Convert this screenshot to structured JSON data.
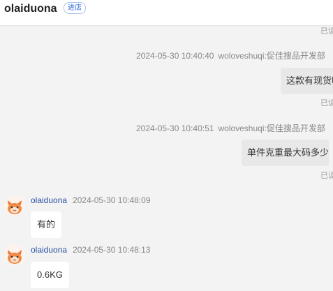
{
  "header": {
    "shop_name": "olaiduona",
    "enter_shop_label": "进店"
  },
  "messages": [
    {
      "read_status": "已读"
    },
    {
      "timestamp": "2024-05-30 10:40:40",
      "sender": "woloveshuqi:促佳搜品开发部",
      "text": "这款有现货吗",
      "read_status": "已读"
    },
    {
      "timestamp": "2024-05-30 10:40:51",
      "sender": "woloveshuqi:促佳搜品开发部",
      "text": "单件克重最大码多少",
      "read_status": "已读"
    },
    {
      "sender": "olaiduona",
      "timestamp": "2024-05-30 10:48:09",
      "text": "有的"
    },
    {
      "sender": "olaiduona",
      "timestamp": "2024-05-30 10:48:13",
      "text": "0.6KG"
    }
  ],
  "icons": {
    "avatar": "tmall-cat-avatar-icon"
  }
}
